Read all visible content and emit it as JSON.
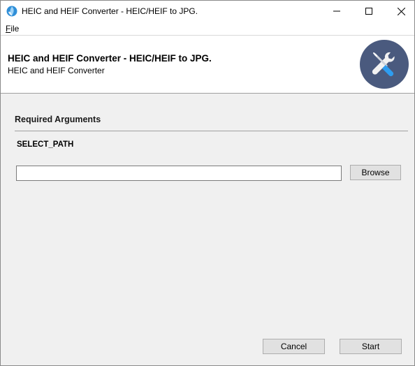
{
  "window": {
    "title": "HEIC and HEIF Converter - HEIC/HEIF to JPG.",
    "controls": [
      "minimize-icon",
      "maximize-icon",
      "close-icon"
    ]
  },
  "menu": {
    "items": [
      {
        "mnemonic": "F",
        "rest": "ile"
      }
    ]
  },
  "header": {
    "title": "HEIC and HEIF Converter - HEIC/HEIF to JPG.",
    "subtitle": "HEIC and HEIF Converter",
    "logo_icon": "tools-icon",
    "logo_bg": "#4a5a7e"
  },
  "form": {
    "section_heading": "Required Arguments",
    "arguments": [
      {
        "label": "SELECT_PATH",
        "value": "",
        "placeholder": ""
      }
    ],
    "browse_label": "Browse"
  },
  "footer": {
    "cancel_label": "Cancel",
    "start_label": "Start"
  }
}
